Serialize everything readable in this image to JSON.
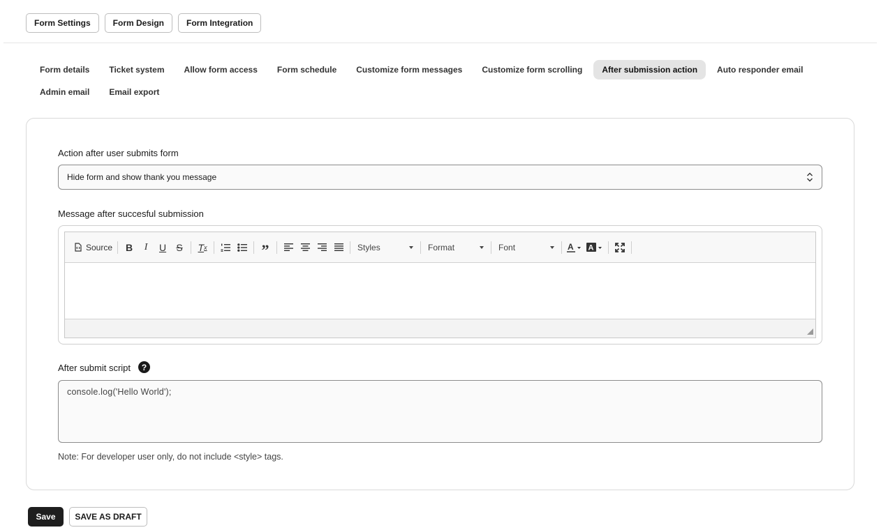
{
  "top_buttons": [
    "Form Settings",
    "Form Design",
    "Form Integration"
  ],
  "subtabs": [
    "Form details",
    "Ticket system",
    "Allow form access",
    "Form schedule",
    "Customize form messages",
    "Customize form scrolling",
    "After submission action",
    "Auto responder email",
    "Admin email",
    "Email export"
  ],
  "active_subtab": "After submission action",
  "form": {
    "action_label": "Action after user submits form",
    "action_value": "Hide form and show thank you message",
    "message_label": "Message after succesful submission",
    "script_label": "After submit script",
    "script_value": "console.log('Hello World');",
    "note": "Note: For developer user only, do not include <style> tags."
  },
  "editor": {
    "source_label": "Source",
    "styles_label": "Styles",
    "format_label": "Format",
    "font_label": "Font"
  },
  "actions": {
    "save_label": "Save",
    "draft_label": "SAVE AS DRAFT"
  },
  "help_glyph": "?"
}
